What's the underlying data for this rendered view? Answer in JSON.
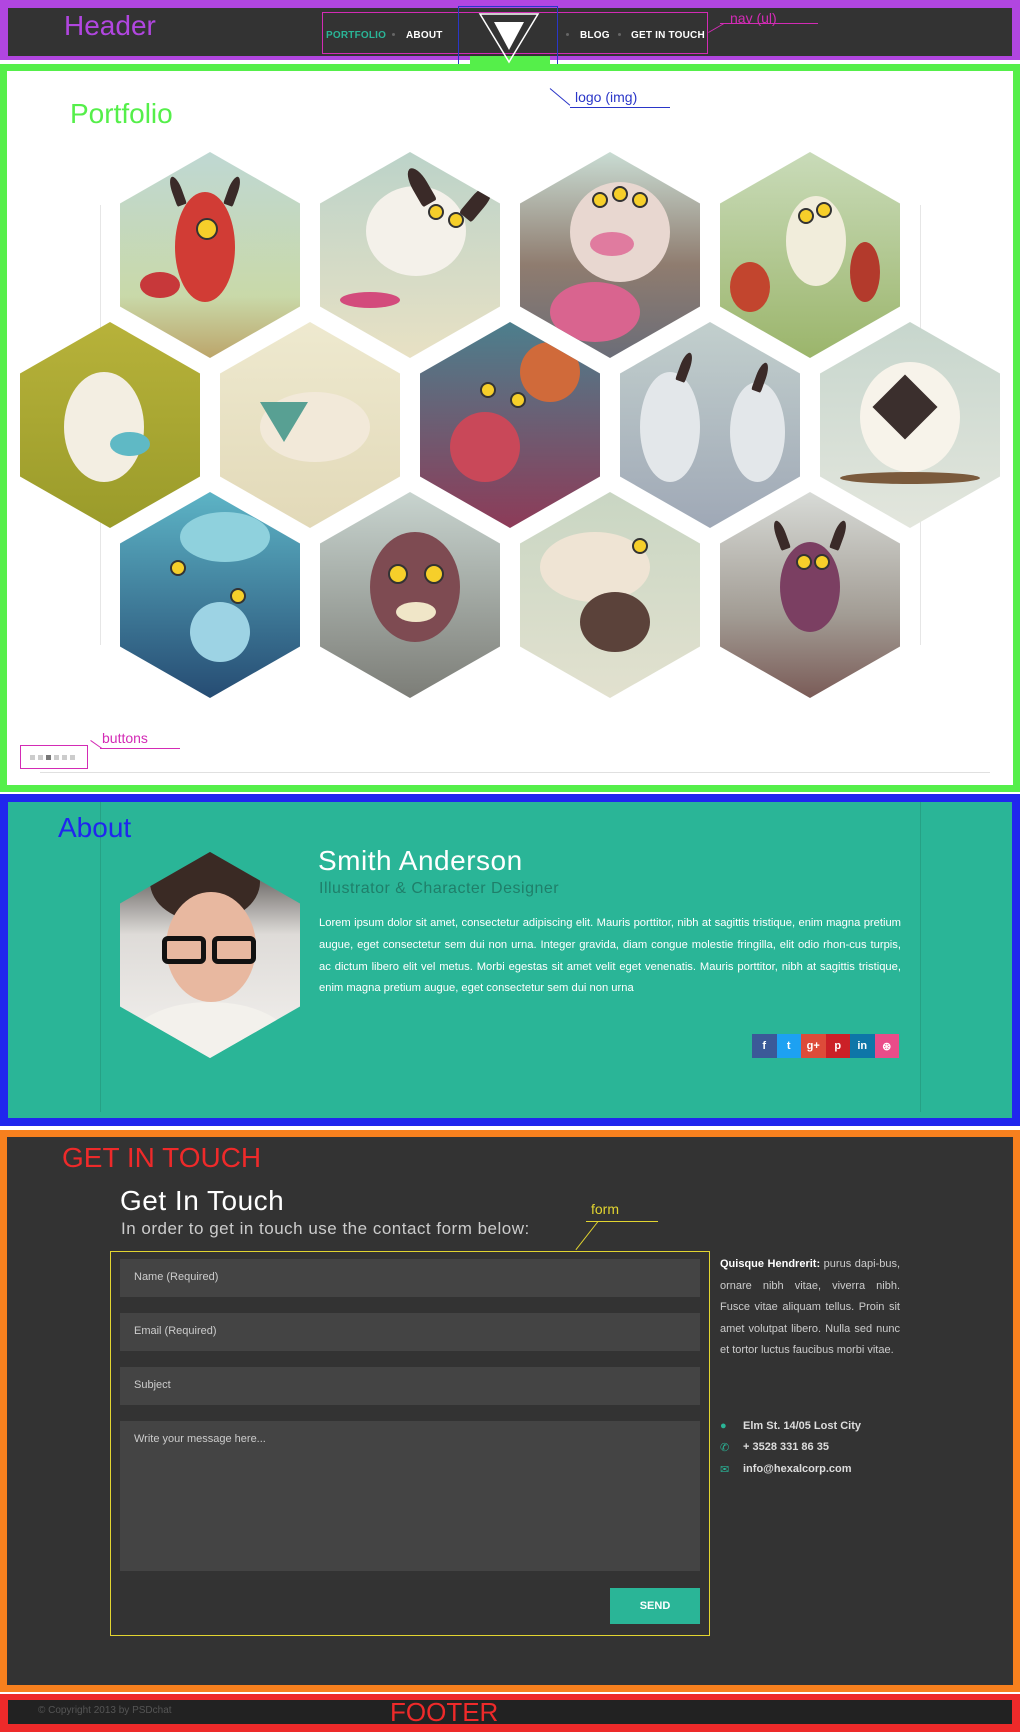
{
  "annotations": {
    "header": "Header",
    "nav": "nav (ul)",
    "logo": "logo (img)",
    "portfolio": "Portfolio",
    "buttons": "buttons",
    "about": "About",
    "contact": "GET IN TOUCH",
    "form": "form",
    "footer": "FOOTER"
  },
  "nav": {
    "items": [
      "PORTFOLIO",
      "ABOUT",
      "BLOG",
      "GET IN TOUCH"
    ],
    "active": "PORTFOLIO"
  },
  "about": {
    "name": "Smith Anderson",
    "role": "Illustrator & Character Designer",
    "bio": "Lorem ipsum dolor sit amet, consectetur adipiscing elit. Mauris porttitor, nibh at sagittis tristique, enim magna pretium augue, eget consectetur sem dui non urna. Integer gravida, diam congue molestie fringilla, elit odio rhon-cus turpis, ac dictum libero elit vel metus. Morbi egestas sit amet velit eget venenatis. Mauris porttitor, nibh at sagittis tristique, enim magna pretium augue, eget consectetur sem dui non urna",
    "socials": [
      {
        "icon": "f",
        "color": "#3b5998"
      },
      {
        "icon": "t",
        "color": "#1da1f2"
      },
      {
        "icon": "g+",
        "color": "#dd4b39"
      },
      {
        "icon": "p",
        "color": "#cb2027"
      },
      {
        "icon": "in",
        "color": "#0e76a8"
      },
      {
        "icon": "⊛",
        "color": "#ea4c89"
      }
    ]
  },
  "contact": {
    "title": "Get In Touch",
    "subtitle": "In order to get in touch use the contact form below:",
    "name_placeholder": "Name (Required)",
    "email_placeholder": "Email (Required)",
    "subject_placeholder": "Subject",
    "message_placeholder": "Write your message here...",
    "send_label": "SEND",
    "info_bold": "Quisque Hendrerit:",
    "info_text": " purus dapi-bus, ornare nibh vitae, viverra nibh. Fusce vitae aliquam tellus. Proin sit amet volutpat libero. Nulla sed nunc et tortor luctus faucibus morbi vitae.",
    "address": "Elm St. 14/05 Lost City",
    "phone": "+ 3528 331 86 35",
    "email": "info@hexalcorp.com"
  },
  "footer": {
    "copyright": "© Copyright 2013 by PSDchat"
  },
  "colors": {
    "accent": "#2ab597",
    "header_frame": "#b146e0",
    "portfolio_frame": "#55ef4a",
    "about_frame": "#2026ee",
    "contact_frame": "#f7801e",
    "footer_frame": "#ee2a2a"
  },
  "carousel": {
    "count": 6,
    "active": 3
  }
}
